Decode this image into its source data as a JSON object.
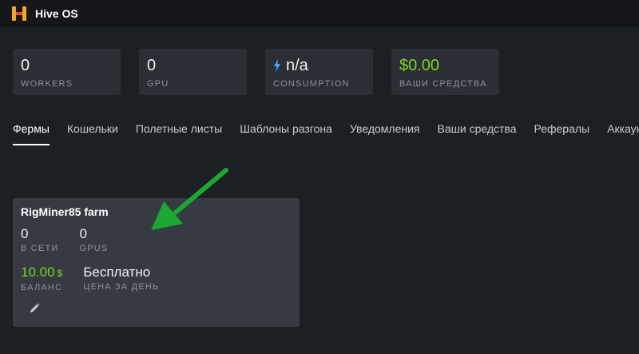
{
  "app": {
    "title": "Hive OS"
  },
  "stats": [
    {
      "value": "0",
      "label": "WORKERS"
    },
    {
      "value": "0",
      "label": "GPU"
    },
    {
      "value": "n/a",
      "label": "CONSUMPTION"
    },
    {
      "value": "$0.00",
      "label": "ВАШИ СРЕДСТВА"
    }
  ],
  "tabs": [
    {
      "label": "Фермы"
    },
    {
      "label": "Кошельки"
    },
    {
      "label": "Полетные листы"
    },
    {
      "label": "Шаблоны разгона"
    },
    {
      "label": "Уведомления"
    },
    {
      "label": "Ваши средства"
    },
    {
      "label": "Рефералы"
    },
    {
      "label": "Аккаунт"
    }
  ],
  "farm": {
    "name": "RigMiner85 farm",
    "online_value": "0",
    "online_label": "В СЕТИ",
    "gpus_value": "0",
    "gpus_label": "GPUS",
    "balance_value": "10.00",
    "balance_currency": "$",
    "balance_label": "БАЛАНС",
    "price_value": "Бесплатно",
    "price_label": "ЦЕНА ЗА ДЕНЬ"
  },
  "colors": {
    "background": "#1c1f24",
    "card": "#2a2e35",
    "farm_card": "#353a43",
    "money_green": "#7ed321",
    "bolt_blue": "#4aa3ff",
    "arrow_green": "#1aa832",
    "logo_orange": "#f5a623"
  },
  "icons": {
    "logo": "hive-logo-icon",
    "consumption": "lightning-bolt-icon",
    "edit": "pencil-icon",
    "annotation": "green-arrow-icon"
  }
}
